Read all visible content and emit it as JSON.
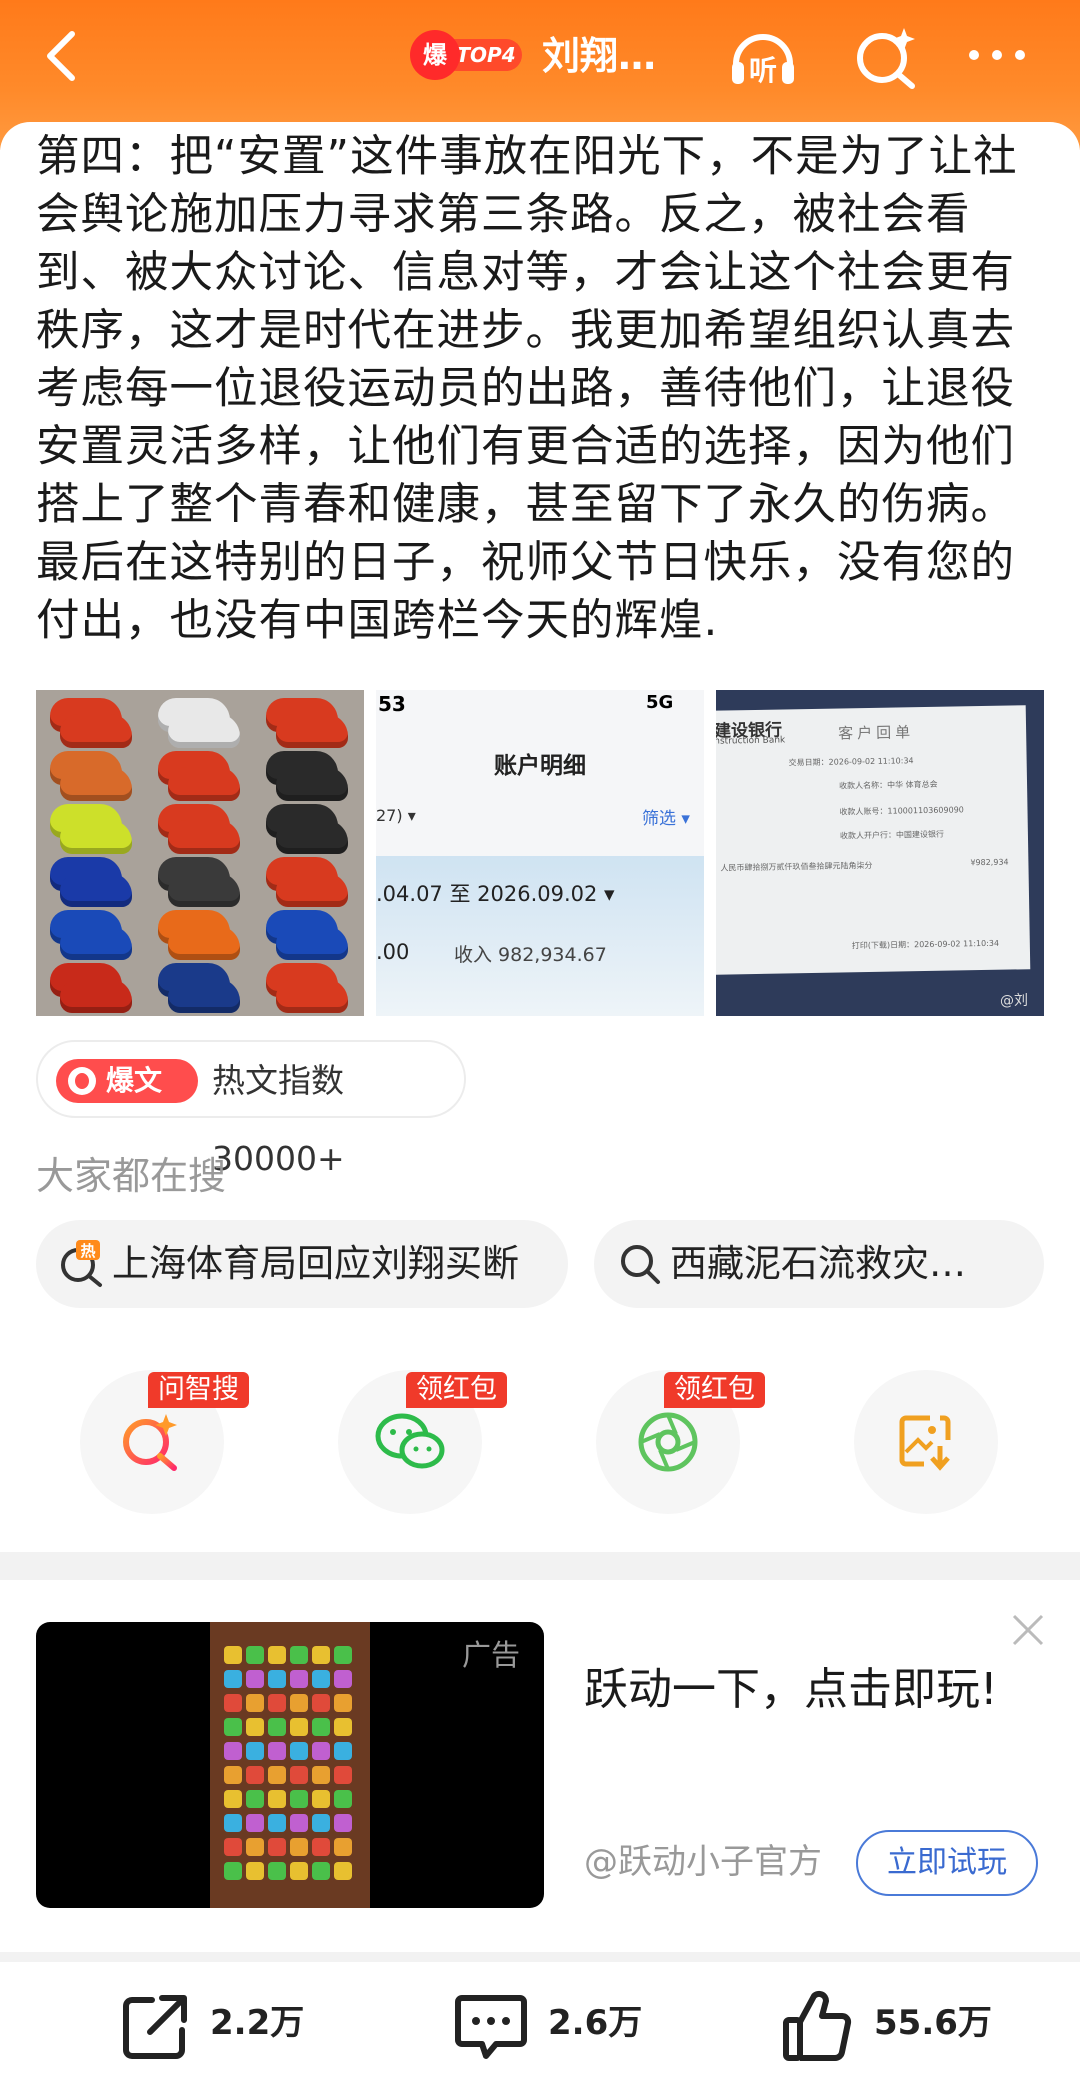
{
  "header": {
    "hot_rank_prefix": "爆",
    "hot_rank": "TOP4",
    "title": "刘翔…",
    "listen_label": "听"
  },
  "article": {
    "text": "第四：把“安置”这件事放在阳光下，不是为了让社会舆论施加压力寻求第三条路。反之，被社会看到、被大众讨论、信息对等，才会让这个社会更有秩序，这才是时代在进步。我更加希望组织认真去考虑每一位退役运动员的出路，善待他们，让退役安置灵活多样，让他们有更合适的选择，因为他们搭上了整个青春和健康，甚至留下了永久的伤病。最后在这特别的日子，祝师父节日快乐，没有您的付出，也没有中国跨栏今天的辉煌."
  },
  "images": {
    "bank_screen": {
      "status_time": "53",
      "status_signal": "5G",
      "title": "账户明细",
      "left_label": "27) ▾",
      "filter_label": "筛选 ▾",
      "date_range": ".04.07 至 2026.09.02 ▾",
      "amount_left": ".00",
      "income_label": "收入 982,934.67"
    },
    "receipt": {
      "bank_name": "建设银行",
      "bank_name_en": "nstruction Bank",
      "doc_title": "客户回单",
      "line1": "交易日期：2026-09-02 11:10:34",
      "line2": "收款人名称：中华 体育总会",
      "line3": "收款人账号：110001103609090",
      "line4": "收款人开户行：中国建设银行",
      "line5": "人民币肆拾捌万贰仟玖佰叁拾肆元陆角柒分",
      "line6": "打印(下载)日期：2026-09-02 11:10:34",
      "amount": "¥982,934",
      "watermark": "@刘"
    }
  },
  "hot_article": {
    "tag": "爆文",
    "text": "热文指数30000+"
  },
  "search_section": {
    "label": "大家都在搜",
    "items": [
      {
        "icon": "hot-search-icon",
        "badge": "热",
        "text": "上海体育局回应刘翔买断"
      },
      {
        "icon": "search-icon",
        "text": "西藏泥石流救灾…"
      }
    ]
  },
  "actions": [
    {
      "icon": "ai-search-icon",
      "badge": "问智搜"
    },
    {
      "icon": "wechat-icon",
      "badge": "领红包"
    },
    {
      "icon": "moments-icon",
      "badge": "领红包"
    },
    {
      "icon": "save-image-icon",
      "badge": ""
    }
  ],
  "ad": {
    "label": "广告",
    "title": "跃动一下，点击即玩!",
    "account": "@跃动小子官方",
    "button": "立即试玩"
  },
  "bottom_bar": {
    "share_count": "2.2万",
    "comment_count": "2.6万",
    "like_count": "55.6万"
  },
  "colors": {
    "header_orange": "#ff7a1a",
    "hot_red": "#ff4d4d",
    "ad_button_blue": "#3a6ad0"
  }
}
